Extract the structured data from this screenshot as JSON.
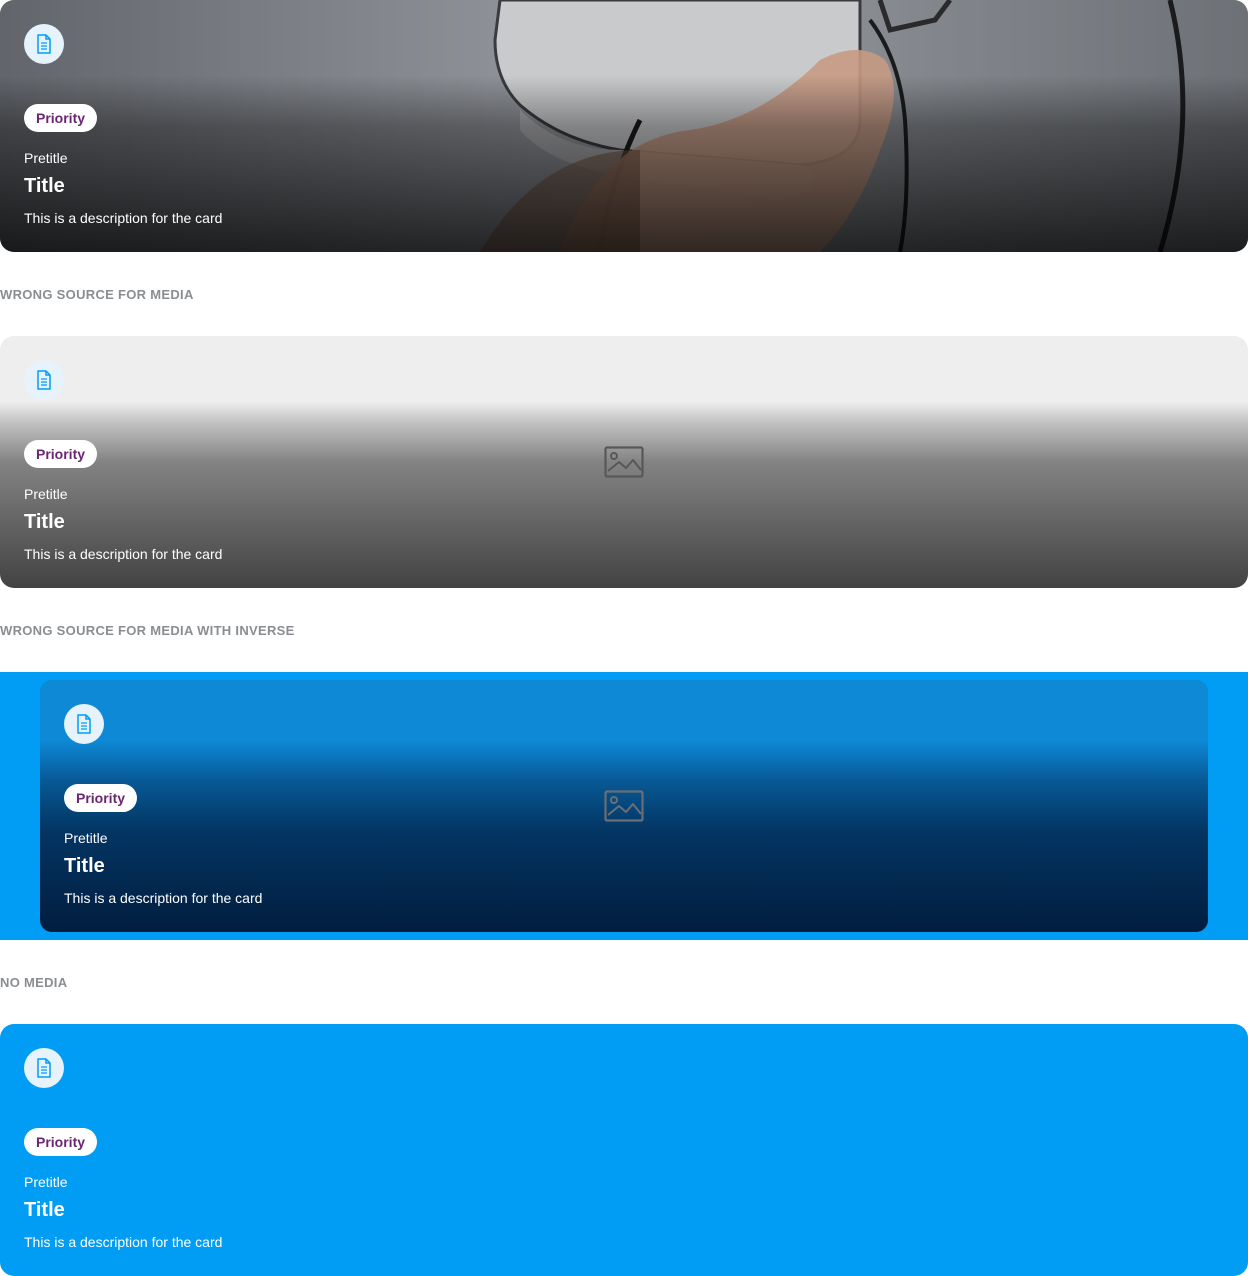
{
  "cards": [
    {
      "badge": "Priority",
      "pretitle": "Pretitle",
      "title": "Title",
      "description": "This is a description for the card",
      "icon": "document-icon"
    },
    {
      "badge": "Priority",
      "pretitle": "Pretitle",
      "title": "Title",
      "description": "This is a description for the card",
      "icon": "document-icon",
      "media_placeholder_icon": "image-placeholder-icon"
    },
    {
      "badge": "Priority",
      "pretitle": "Pretitle",
      "title": "Title",
      "description": "This is a description for the card",
      "icon": "document-icon",
      "media_placeholder_icon": "image-placeholder-icon"
    },
    {
      "badge": "Priority",
      "pretitle": "Pretitle",
      "title": "Title",
      "description": "This is a description for the card",
      "icon": "document-icon"
    }
  ],
  "section_labels": {
    "wrong_source": "WRONG SOURCE FOR MEDIA",
    "wrong_source_inverse": "WRONG SOURCE FOR MEDIA WITH INVERSE",
    "no_media": "NO MEDIA"
  },
  "colors": {
    "brand_blue": "#019df4",
    "badge_text": "#6b2670",
    "icon_blue": "#019df4",
    "section_label": "#8a8d91"
  }
}
